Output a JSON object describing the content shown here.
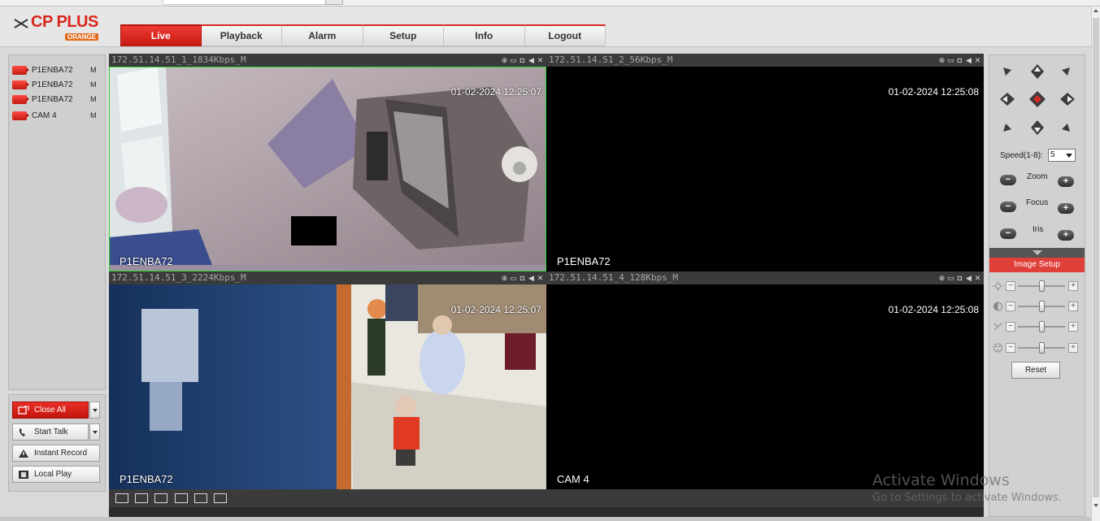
{
  "brand": {
    "name": "CP PLUS",
    "sub": "ORANGE"
  },
  "nav": {
    "tabs": [
      "Live",
      "Playback",
      "Alarm",
      "Setup",
      "Info",
      "Logout"
    ],
    "active": "Live"
  },
  "devices": [
    {
      "name": "P1ENBA72",
      "stream": "M"
    },
    {
      "name": "P1ENBA72",
      "stream": "M"
    },
    {
      "name": "P1ENBA72",
      "stream": "M"
    },
    {
      "name": "CAM 4",
      "stream": "M"
    }
  ],
  "left_controls": {
    "close_all": "Close All",
    "start_talk": "Start Talk",
    "instant_record": "Instant Record",
    "local_play": "Local Play"
  },
  "channels": [
    {
      "header": "172.51.14.51_1_1834Kbps_M",
      "timestamp": "01-02-2024 12:25:07",
      "label": "P1ENBA72",
      "selected": true
    },
    {
      "header": "172.51.14.51_2_56Kbps_M",
      "timestamp": "01-02-2024 12:25:08",
      "label": "P1ENBA72",
      "selected": false
    },
    {
      "header": "172.51.14.51_3_2224Kbps_M",
      "timestamp": "01-02-2024 12:25:07",
      "label": "P1ENBA72",
      "selected": false
    },
    {
      "header": "172.51.14.51_4_128Kbps_M",
      "timestamp": "01-02-2024 12:25:08",
      "label": "CAM 4",
      "selected": false
    }
  ],
  "ptz": {
    "speed_label": "Speed(1-8):",
    "speed_value": "5",
    "zoom_label": "Zoom",
    "focus_label": "Focus",
    "iris_label": "Iris",
    "minus": "−",
    "plus": "+"
  },
  "image_setup": {
    "title": "Image Setup",
    "reset": "Reset",
    "minus": "−",
    "plus": "+"
  },
  "watermark": {
    "line1": "Activate Windows",
    "line2": "Go to Settings to activate Windows."
  },
  "colors": {
    "accent": "#d52a24",
    "video_bg": "#000000",
    "selection": "#2cd62c"
  }
}
